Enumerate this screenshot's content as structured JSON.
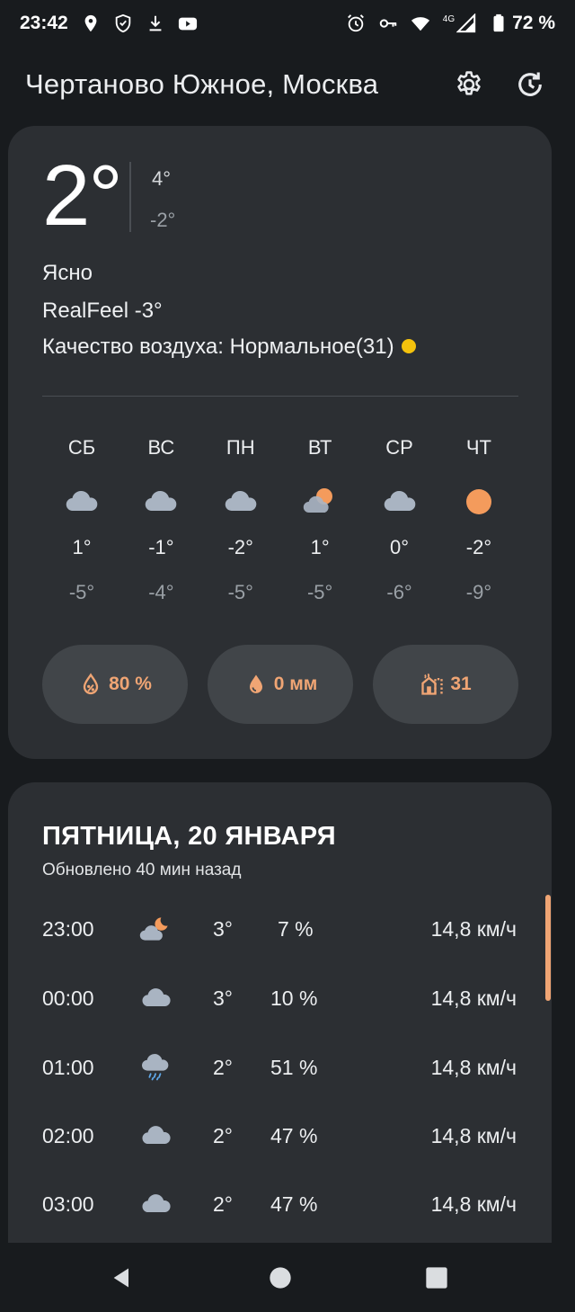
{
  "status_bar": {
    "time": "23:42",
    "battery": "72 %",
    "network": "4G",
    "icons_left": [
      "location-icon",
      "vpn-shield-icon",
      "download-icon",
      "youtube-icon"
    ],
    "icons_right": [
      "alarm-icon",
      "key-icon",
      "wifi-icon",
      "signal-icon",
      "battery-icon"
    ]
  },
  "header": {
    "title": "Чертаново Южное, Москва",
    "icons": [
      "settings-icon",
      "history-refresh-icon"
    ]
  },
  "current": {
    "temp": "2°",
    "high": "4°",
    "low": "-2°",
    "condition": "Ясно",
    "realfeel": "RealFeel -3°",
    "air_quality": "Качество воздуха: Нормальное(31)",
    "aq_color": "#f4c20d"
  },
  "forecast": [
    {
      "day": "СБ",
      "icon": "cloud",
      "high": "1°",
      "low": "-5°"
    },
    {
      "day": "ВС",
      "icon": "cloud",
      "high": "-1°",
      "low": "-4°"
    },
    {
      "day": "ПН",
      "icon": "cloud",
      "high": "-2°",
      "low": "-5°"
    },
    {
      "day": "ВТ",
      "icon": "partly-cloudy",
      "high": "1°",
      "low": "-5°"
    },
    {
      "day": "СР",
      "icon": "cloud",
      "high": "0°",
      "low": "-6°"
    },
    {
      "day": "ЧТ",
      "icon": "sun",
      "high": "-2°",
      "low": "-9°"
    }
  ],
  "pills": {
    "humidity": "80 %",
    "precipitation": "0 мм",
    "aqi": "31"
  },
  "hourly": {
    "date": "ПЯТНИЦА, 20 ЯНВАРЯ",
    "updated": "Обновлено 40 мин назад",
    "rows": [
      {
        "time": "23:00",
        "icon": "partly-cloudy-night",
        "temp": "3°",
        "humidity": "7 %",
        "wind": "14,8 км/ч"
      },
      {
        "time": "00:00",
        "icon": "cloud",
        "temp": "3°",
        "humidity": "10 %",
        "wind": "14,8 км/ч"
      },
      {
        "time": "01:00",
        "icon": "rain",
        "temp": "2°",
        "humidity": "51 %",
        "wind": "14,8 км/ч"
      },
      {
        "time": "02:00",
        "icon": "cloud",
        "temp": "2°",
        "humidity": "47 %",
        "wind": "14,8 км/ч"
      },
      {
        "time": "03:00",
        "icon": "cloud",
        "temp": "2°",
        "humidity": "47 %",
        "wind": "14,8 км/ч"
      }
    ]
  },
  "colors": {
    "background": "#181b1e",
    "card": "#2c2f33",
    "pill": "#414549",
    "accent": "#f0a574",
    "cloud": "#a9b4c2",
    "sun": "#f49b5c"
  },
  "nav": [
    "back-icon",
    "home-icon",
    "recents-icon"
  ]
}
